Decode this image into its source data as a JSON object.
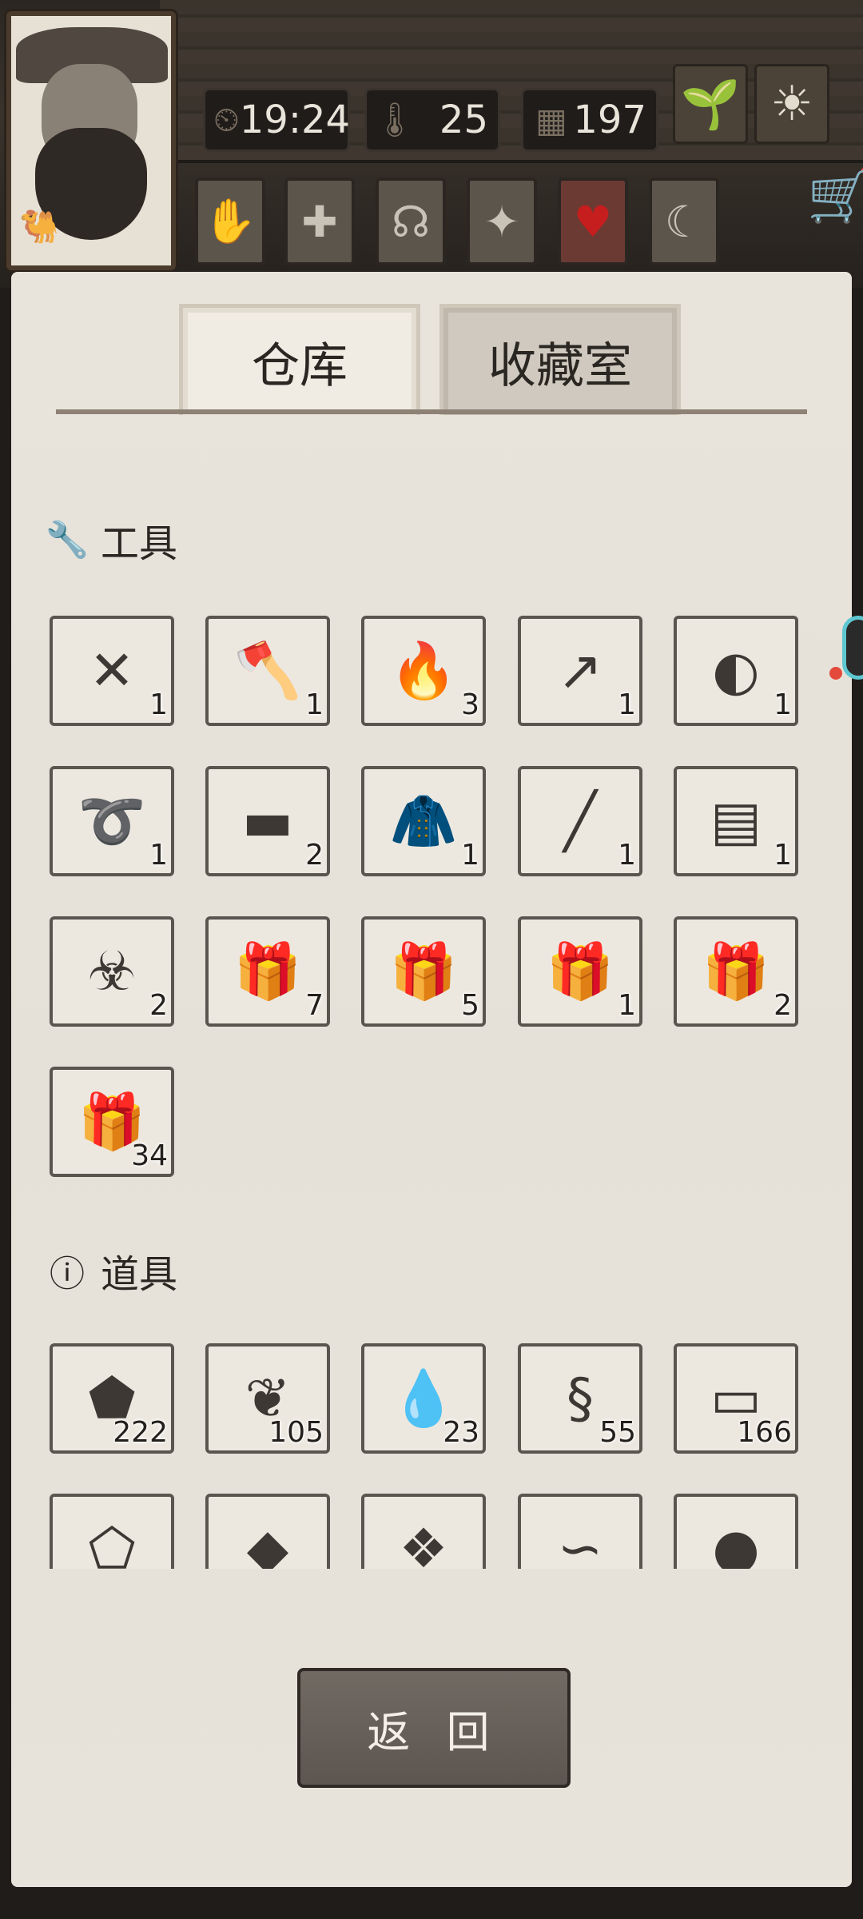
{
  "hud": {
    "time": "19:24",
    "temperature": "25",
    "day": "197",
    "icons": [
      "clock-icon",
      "thermometer-icon",
      "calendar-icon",
      "sprout-icon",
      "sun-icon"
    ]
  },
  "categories": [
    {
      "name": "bandage-hand-icon",
      "glyph": "✋"
    },
    {
      "name": "medical-cross-icon",
      "glyph": "✚"
    },
    {
      "name": "stomach-icon",
      "glyph": "☊"
    },
    {
      "name": "mind-icon",
      "glyph": "✦"
    },
    {
      "name": "heart-icon",
      "glyph": "♥"
    },
    {
      "name": "moon-star-icon",
      "glyph": "☾"
    }
  ],
  "tabs": {
    "warehouse": "仓库",
    "collection": "收藏室"
  },
  "sections": {
    "tools": "工具",
    "props": "道具"
  },
  "tools": [
    {
      "name": "crossbow",
      "glyph": "✕",
      "count": "1"
    },
    {
      "name": "axe",
      "glyph": "🪓",
      "count": "1"
    },
    {
      "name": "torch",
      "glyph": "🔥",
      "count": "3"
    },
    {
      "name": "spear",
      "glyph": "↗",
      "count": "1"
    },
    {
      "name": "frying-pan",
      "glyph": "◐",
      "count": "1"
    },
    {
      "name": "whip",
      "glyph": "➰",
      "count": "1"
    },
    {
      "name": "drill",
      "glyph": "▬",
      "count": "2"
    },
    {
      "name": "fur-coat",
      "glyph": "🧥",
      "count": "1"
    },
    {
      "name": "pipe-weapon",
      "glyph": "╱",
      "count": "1"
    },
    {
      "name": "fur-skirt",
      "glyph": "▤",
      "count": "1"
    },
    {
      "name": "hazmat-suit",
      "glyph": "☣",
      "count": "2"
    },
    {
      "name": "food-giftbox",
      "glyph": "🎁",
      "count": "7"
    },
    {
      "name": "medical-giftbox",
      "glyph": "🎁",
      "count": "5"
    },
    {
      "name": "weapon-giftbox",
      "glyph": "🎁",
      "count": "1"
    },
    {
      "name": "tool-giftbox",
      "glyph": "🎁",
      "count": "2"
    },
    {
      "name": "material-giftbox",
      "glyph": "🎁",
      "count": "34"
    }
  ],
  "props": [
    {
      "name": "stone",
      "glyph": "⬟",
      "count": "222"
    },
    {
      "name": "leaf",
      "glyph": "❦",
      "count": "105"
    },
    {
      "name": "water-puddle",
      "glyph": "💧",
      "count": "23"
    },
    {
      "name": "vine",
      "glyph": "§",
      "count": "55"
    },
    {
      "name": "wood-planks",
      "glyph": "▭",
      "count": "166"
    },
    {
      "name": "flint",
      "glyph": "⬠",
      "count": ""
    },
    {
      "name": "ore",
      "glyph": "◆",
      "count": ""
    },
    {
      "name": "hide",
      "glyph": "❖",
      "count": ""
    },
    {
      "name": "worm",
      "glyph": "∽",
      "count": ""
    },
    {
      "name": "tar",
      "glyph": "●",
      "count": ""
    }
  ],
  "back_label": "返 回"
}
